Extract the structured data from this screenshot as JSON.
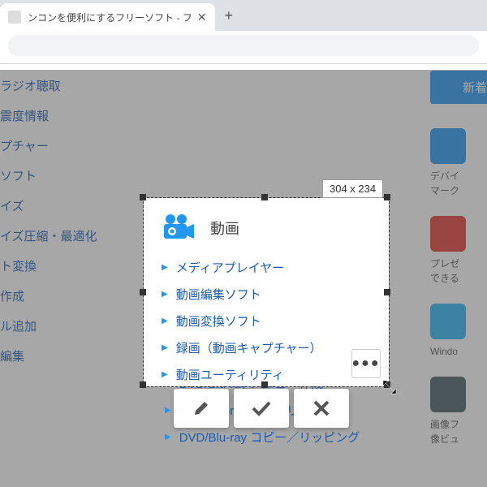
{
  "browser": {
    "tab_title": "ンコンを便利にするフリーソフト - フ",
    "url_partial": ""
  },
  "left_links": [
    "ラジオ聴取",
    "震度情報",
    "プチャー",
    "ソフト",
    "イズ",
    "イズ圧縮・最適化",
    "ト変換",
    "作成",
    "ル追加",
    "編集"
  ],
  "right": {
    "blue_button": "新着",
    "cards": [
      {
        "icon_bg": "#2196f3",
        "text": "デバイ\nマーク"
      },
      {
        "icon_bg": "#e53935",
        "text": "プレゼ\nできる"
      },
      {
        "icon_bg": "#29b6f6",
        "text": "Windo"
      },
      {
        "icon_bg": "#455a64",
        "text": "画像フ\n像ビュ"
      }
    ]
  },
  "selection": {
    "tooltip": "304 x 234",
    "heading": "動画",
    "items": [
      "メディアプレイヤー",
      "動画編集ソフト",
      "動画変換ソフト",
      "録画（動画キャプチャー）",
      "動画ユーティリティ"
    ],
    "more": "●●●"
  },
  "bg_continue": {
    "items": [
      "DVD/Blu-ray メニュー作成",
      "DVD/Blu-ray オーサリング",
      "DVD/Blu-ray コピー／リッピング"
    ]
  },
  "toolbar": {
    "edit_label": "Edit",
    "confirm_label": "Confirm",
    "cancel_label": "Cancel"
  }
}
